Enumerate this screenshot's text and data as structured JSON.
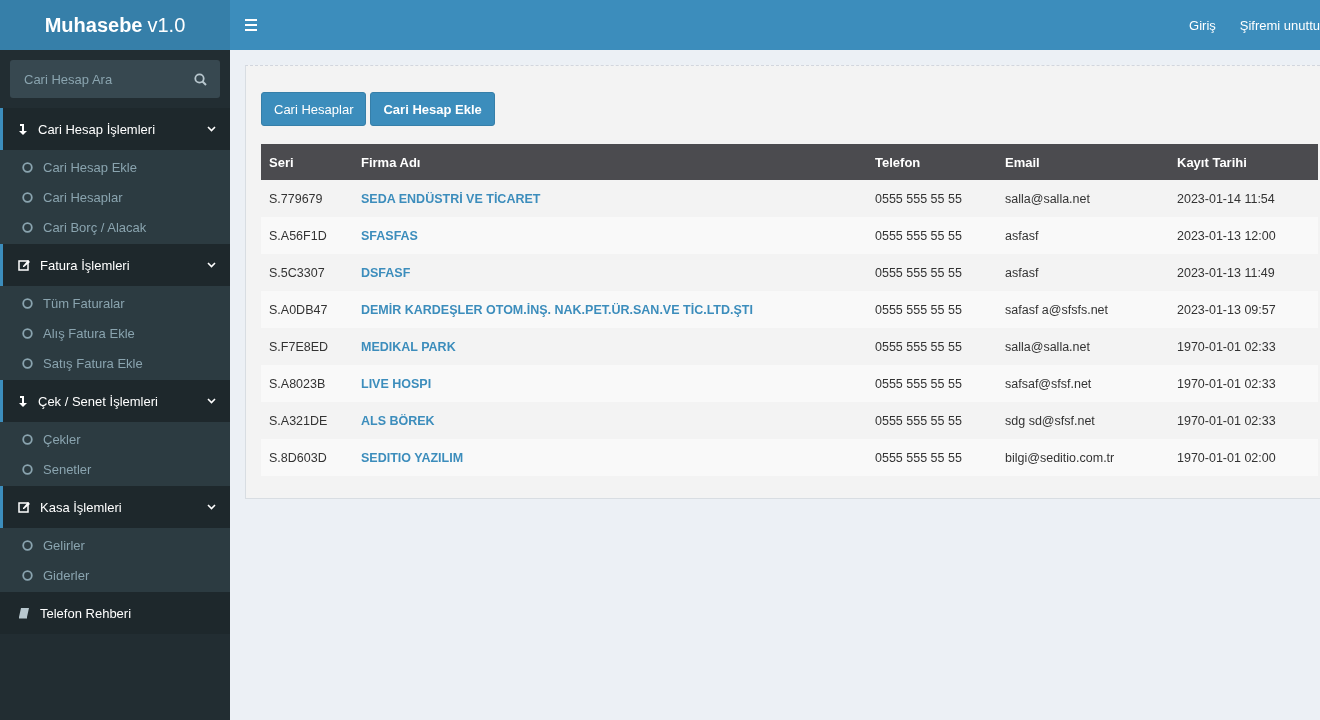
{
  "brand": {
    "title": "Muhasebe",
    "version": "v1.0"
  },
  "header": {
    "links": [
      "Giriş",
      "Şifremi unuttu"
    ]
  },
  "sidebar": {
    "search": {
      "placeholder": "Cari Hesap Ara"
    },
    "groups": [
      {
        "label": "Cari Hesap İşlemleri",
        "kind": "arrow",
        "expanded": true,
        "children": [
          {
            "label": "Cari Hesap Ekle"
          },
          {
            "label": "Cari Hesaplar"
          },
          {
            "label": "Cari Borç / Alacak"
          }
        ]
      },
      {
        "label": "Fatura İşlemleri",
        "kind": "edit",
        "expanded": true,
        "children": [
          {
            "label": "Tüm Faturalar"
          },
          {
            "label": "Alış Fatura Ekle"
          },
          {
            "label": "Satış Fatura Ekle"
          }
        ]
      },
      {
        "label": "Çek / Senet İşlemleri",
        "kind": "arrow",
        "expanded": true,
        "children": [
          {
            "label": "Çekler"
          },
          {
            "label": "Senetler"
          }
        ]
      },
      {
        "label": "Kasa İşlemleri",
        "kind": "edit",
        "expanded": true,
        "children": [
          {
            "label": "Gelirler"
          },
          {
            "label": "Giderler"
          }
        ]
      },
      {
        "label": "Telefon Rehberi",
        "kind": "book",
        "expanded": false
      }
    ]
  },
  "buttons": [
    {
      "label": "Cari Hesaplar",
      "bold": false
    },
    {
      "label": "Cari Hesap Ekle",
      "bold": true
    }
  ],
  "table": {
    "columns": [
      "Seri",
      "Firma Adı",
      "Telefon",
      "Email",
      "Kayıt Tarihi"
    ],
    "rows": [
      [
        "S.779679",
        "SEDA ENDÜSTRİ VE TİCARET",
        "0555 555 55 55",
        "salla@salla.net",
        "2023-01-14 11:54"
      ],
      [
        "S.A56F1D",
        "SFASFAS",
        "0555 555 55 55",
        "asfasf",
        "2023-01-13 12:00"
      ],
      [
        "S.5C3307",
        "DSFASF",
        "0555 555 55 55",
        "asfasf",
        "2023-01-13 11:49"
      ],
      [
        "S.A0DB47",
        "DEMİR KARDEŞLER OTOM.İNŞ. NAK.PET.ÜR.SAN.VE TİC.LTD.ŞTI",
        "0555 555 55 55",
        "safasf a@sfsfs.net",
        "2023-01-13 09:57"
      ],
      [
        "S.F7E8ED",
        "MEDIKAL PARK",
        "0555 555 55 55",
        "salla@salla.net",
        "1970-01-01 02:33"
      ],
      [
        "S.A8023B",
        "LIVE HOSPI",
        "0555 555 55 55",
        "safsaf@sfsf.net",
        "1970-01-01 02:33"
      ],
      [
        "S.A321DE",
        "ALS BÖREK",
        "0555 555 55 55",
        "sdg sd@sfsf.net",
        "1970-01-01 02:33"
      ],
      [
        "S.8D603D",
        "SEDITIO YAZILIM",
        "0555 555 55 55",
        "bilgi@seditio.com.tr",
        "1970-01-01 02:00"
      ]
    ]
  }
}
